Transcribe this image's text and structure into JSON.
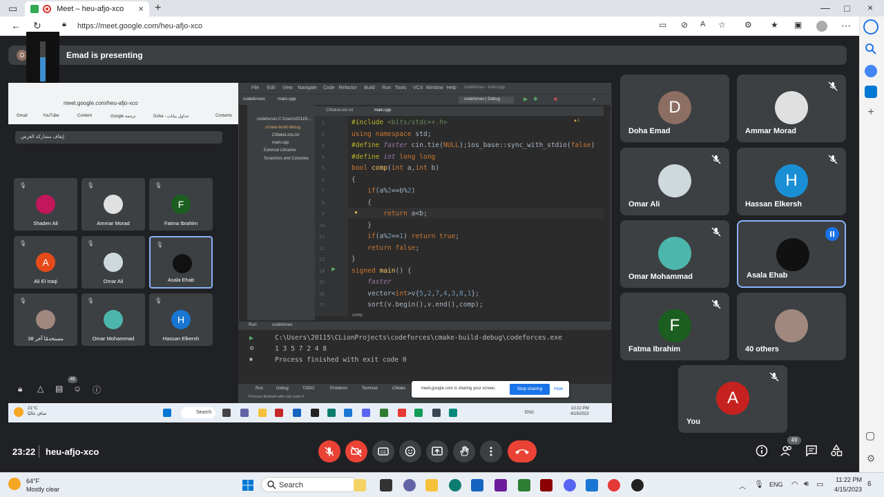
{
  "browser": {
    "tab_title": "Meet – heu-afjo-xco",
    "url": "https://meet.google.com/heu-afjo-xco"
  },
  "presenter": {
    "avatar_letter": "D",
    "label": "Emad is presenting"
  },
  "volume_overlay": {
    "value": "61",
    "level": 0.61
  },
  "shared_screen": {
    "inner_browser_url": "meet.google.com/heu-afjo-xco",
    "bookmarks": [
      "Gmail",
      "YouTube",
      "Content",
      "Google ترجمة",
      "Doha - جداول بيانات",
      "Contents"
    ],
    "stop_share_label": "إيقاف مشاركة العرض",
    "inner_participants": [
      {
        "name": "Shaden Ali",
        "letter": "",
        "color": "#c2185b"
      },
      {
        "name": "Ammar Morad",
        "letter": "",
        "color": "#e0e0e0"
      },
      {
        "name": "Fatma Ibrahim",
        "letter": "F",
        "color": "#1b5e20"
      },
      {
        "name": "Ali El Iraqi",
        "letter": "A",
        "color": "#e64a19"
      },
      {
        "name": "Omar Ali",
        "letter": "",
        "color": "#cfd8dc"
      },
      {
        "name": "Asala Ehab",
        "letter": "",
        "color": "#111111"
      },
      {
        "name": "38 مستخدمًا آخر",
        "letter": "",
        "color": "#a1887f"
      },
      {
        "name": "Omar Mohammad",
        "letter": "",
        "color": "#4db6ac"
      },
      {
        "name": "Hassan Elkersh",
        "letter": "H",
        "color": "#1976d2"
      }
    ],
    "inner_people_count": "49",
    "ide": {
      "menu": [
        "File",
        "Edit",
        "View",
        "Navigate",
        "Code",
        "Refactor",
        "Build",
        "Run",
        "Tools",
        "VCS",
        "Window",
        "Help"
      ],
      "window_title": "codeforces - main.cpp",
      "project_name": "codeforces",
      "open_file": "main.cpp",
      "run_config": "codeforces | Debug",
      "project_tree": [
        "codeforces  C:\\Users\\20115\\...",
        "cmake-build-debug",
        "CMakeLists.txt",
        "main.cpp",
        "External Libraries",
        "Scratches and Consoles"
      ],
      "editor_tabs": [
        "CMakeLists.txt",
        "main.cpp"
      ],
      "code_lines": [
        {
          "n": "1",
          "text": "#include <bits/stdc++.h>"
        },
        {
          "n": "2",
          "text": "using namespace std;"
        },
        {
          "n": "3",
          "text": "#define faster cin.tie(NULL);ios_base::sync_with_stdio(false)"
        },
        {
          "n": "4",
          "text": "#define int long long"
        },
        {
          "n": "5",
          "text": "bool comp(int a,int b)"
        },
        {
          "n": "6",
          "text": "{"
        },
        {
          "n": "7",
          "text": "    if(a%2==b%2)"
        },
        {
          "n": "8",
          "text": "    {"
        },
        {
          "n": "9",
          "text": "        return a<b;"
        },
        {
          "n": "10",
          "text": "    }"
        },
        {
          "n": "11",
          "text": "    if(a%2==1) return true;"
        },
        {
          "n": "12",
          "text": "    return false;"
        },
        {
          "n": "13",
          "text": "}"
        },
        {
          "n": "14",
          "text": "signed main() {"
        },
        {
          "n": "15",
          "text": "    faster"
        },
        {
          "n": "16",
          "text": "    vector<int>v{5,2,7,4,3,8,1};"
        },
        {
          "n": "17",
          "text": "    sort(v.begin(),v.end(),comp);"
        }
      ],
      "breadcrumb": "comp",
      "run_tabs": [
        "Run:",
        "codeforces"
      ],
      "output_lines": [
        "C:\\Users\\20115\\CLionProjects\\codeforces\\cmake-build-debug\\codeforces.exe",
        "1 3 5 7 2 4 8",
        "Process finished with exit code 0"
      ],
      "bottom_tabs": [
        "Run",
        "Debug",
        "TODO",
        "Problems",
        "Terminal",
        "CMake"
      ],
      "status_text": "Process finished with exit code 0"
    },
    "share_notice": {
      "text": "meet.google.com is sharing your screen.",
      "stop_label": "Stop sharing",
      "hide_label": "Hide"
    },
    "inner_taskbar": {
      "weather_temp": "21°C",
      "weather_desc": "صافٍ غالبًا",
      "search": "Search",
      "lang": "ENG",
      "time": "10:22 PM",
      "date": "4/15/2023"
    }
  },
  "participants": [
    {
      "name": "Doha Emad",
      "letter": "D",
      "color": "#8d6e63",
      "muted": false
    },
    {
      "name": "Ammar Morad",
      "letter": "",
      "color": "#e0e0e0",
      "muted": true
    },
    {
      "name": "Omar Ali",
      "letter": "",
      "color": "#cfd8dc",
      "muted": true
    },
    {
      "name": "Hassan Elkersh",
      "letter": "H",
      "color": "#1a8fd6",
      "muted": true
    },
    {
      "name": "Omar Mohammad",
      "letter": "",
      "color": "#4db6ac",
      "muted": true
    },
    {
      "name": "Asala Ehab",
      "letter": "",
      "color": "#111111",
      "muted": false,
      "speaking": true
    },
    {
      "name": "Fatma Ibrahim",
      "letter": "F",
      "color": "#1b5e20",
      "muted": true
    },
    {
      "name": "40 others",
      "letter": "",
      "color": "#a1887f",
      "muted": false
    },
    {
      "name": "You",
      "letter": "A",
      "color": "#c5221f",
      "muted": true
    }
  ],
  "meeting": {
    "time": "23:22",
    "code": "heu-afjo-xco",
    "people_count": "49"
  },
  "taskbar": {
    "weather_temp": "64°F",
    "weather_desc": "Mostly clear",
    "search": "Search",
    "lang": "ENG",
    "time": "11:22 PM",
    "date": "4/15/2023",
    "notifications": "6"
  }
}
